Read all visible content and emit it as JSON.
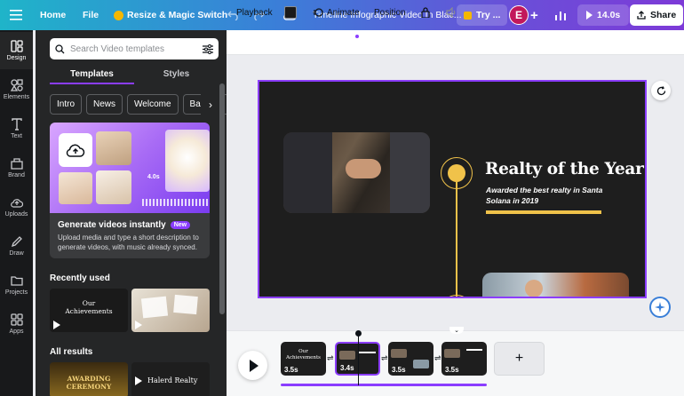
{
  "topbar": {
    "home": "Home",
    "file": "File",
    "resize": "Resize & Magic Switch",
    "doc_title": "Timeline Infographic Video In Blac...",
    "try_label": "Try ...",
    "avatar_initial": "E",
    "duration": "14.0s",
    "share": "Share"
  },
  "rail": {
    "items": [
      {
        "label": "Design",
        "icon": "design-icon"
      },
      {
        "label": "Elements",
        "icon": "elements-icon"
      },
      {
        "label": "Text",
        "icon": "text-icon"
      },
      {
        "label": "Brand",
        "icon": "brand-icon"
      },
      {
        "label": "Uploads",
        "icon": "uploads-icon"
      },
      {
        "label": "Draw",
        "icon": "draw-icon"
      },
      {
        "label": "Projects",
        "icon": "projects-icon"
      },
      {
        "label": "Apps",
        "icon": "apps-icon"
      }
    ]
  },
  "panel": {
    "search_placeholder": "Search Video templates",
    "tabs": [
      "Templates",
      "Styles"
    ],
    "chips": [
      "Intro",
      "News",
      "Welcome",
      "Backgro"
    ],
    "promo": {
      "title": "Generate videos instantly",
      "badge": "New",
      "desc": "Upload media and type a short description to generate videos, with music already synced.",
      "duration_badge": "4.0s"
    },
    "recently_used": "Recently used",
    "recent_thumb1_line1": "Our",
    "recent_thumb1_line2": "Achievements",
    "all_results": "All results",
    "result_thumb1": "AWARDING CEREMONY",
    "result_thumb2": "Halerd Realty"
  },
  "editor_toolbar": {
    "playback": "Playback",
    "animate": "Animate",
    "position": "Position"
  },
  "slide": {
    "title": "Realty of the Year",
    "subtitle": "Awarded the best realty in Santa Solana in 2019"
  },
  "timeline": {
    "clips": [
      {
        "duration": "3.5s",
        "title1": "Our",
        "title2": "Achievements"
      },
      {
        "duration": "3.4s"
      },
      {
        "duration": "3.5s"
      },
      {
        "duration": "3.5s"
      }
    ]
  },
  "colors": {
    "accent": "#8b3dff",
    "gold": "#f0c24a",
    "slide_bg": "#1e1e1e"
  }
}
